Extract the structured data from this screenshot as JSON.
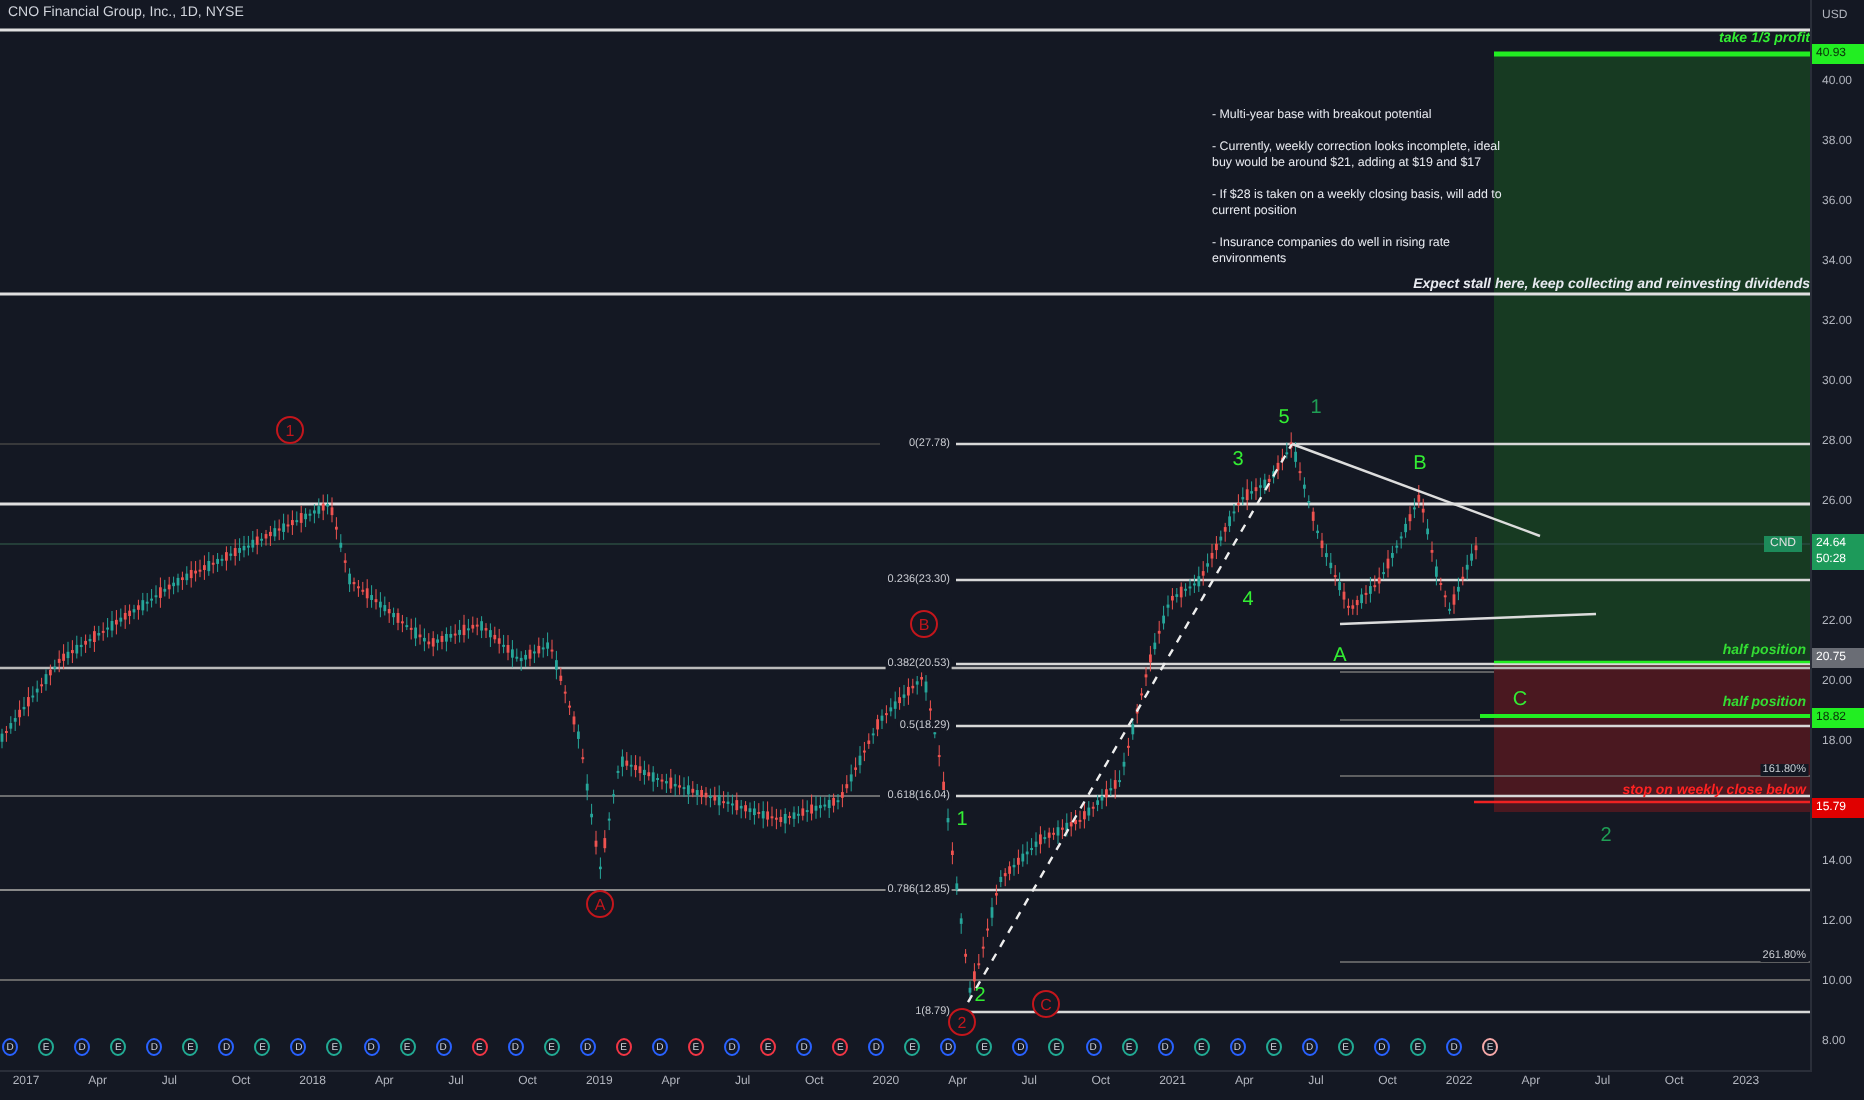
{
  "header": {
    "title": "CNO Financial Group, Inc., 1D, NYSE"
  },
  "notes": [
    "- Multi-year base with breakout potential",
    "- Currently, weekly correction looks incomplete, ideal buy would be around $21, adding at $19 and $17",
    "- If $28 is taken on a weekly closing basis, will add to current position",
    "- Insurance companies do well in rising rate environments"
  ],
  "annotations": [
    {
      "kind": "profit",
      "text": "take 1/3 profit"
    },
    {
      "kind": "note",
      "text": "Expect stall here, keep collecting and reinvesting dividends"
    },
    {
      "kind": "entry",
      "text": "half position"
    },
    {
      "kind": "entry",
      "text": "half position"
    },
    {
      "kind": "stop",
      "text": "stop on weekly close below"
    }
  ],
  "fib_levels": [
    "0(27.78)",
    "0.236(23.30)",
    "0.382(20.53)",
    "0.5(18.29)",
    "0.618(16.04)",
    "0.786(12.85)",
    "1(8.79)"
  ],
  "extensions": [
    "161.80%",
    "261.80%"
  ],
  "wave_labels": [
    {
      "text": "1",
      "kind": "circled",
      "color": "#c3161c"
    },
    {
      "text": "5",
      "kind": "plain",
      "color": "#33ee33"
    },
    {
      "text": "1",
      "kind": "plain",
      "color": "#1f9e55"
    },
    {
      "text": "3",
      "kind": "plain",
      "color": "#33ee33"
    },
    {
      "text": "B",
      "kind": "plain",
      "color": "#33ee33"
    },
    {
      "text": "B",
      "kind": "circled",
      "color": "#c3161c"
    },
    {
      "text": "4",
      "kind": "plain",
      "color": "#33ee33"
    },
    {
      "text": "A",
      "kind": "plain",
      "color": "#33ee33"
    },
    {
      "text": "C",
      "kind": "plain",
      "color": "#33ee33"
    },
    {
      "text": "1",
      "kind": "plain",
      "color": "#33ee33"
    },
    {
      "text": "2",
      "kind": "plain",
      "color": "#1f9e55"
    },
    {
      "text": "A",
      "kind": "circled",
      "color": "#c3161c"
    },
    {
      "text": "2",
      "kind": "plain",
      "color": "#33ee33"
    },
    {
      "text": "C",
      "kind": "circled",
      "color": "#c3161c"
    },
    {
      "text": "2",
      "kind": "circled",
      "color": "#c3161c"
    }
  ],
  "price_axis": {
    "currency": "USD",
    "ticks": [
      "40.00",
      "38.00",
      "36.00",
      "34.00",
      "32.00",
      "30.00",
      "28.00",
      "26.00",
      "22.00",
      "20.00",
      "18.00",
      "14.00",
      "12.00",
      "10.00",
      "8.00"
    ]
  },
  "symbol_tag": "CND",
  "price_tags": [
    {
      "kind": "target",
      "text": "40.93"
    },
    {
      "kind": "last",
      "text": "24.64",
      "countdown": "50:28"
    },
    {
      "kind": "level",
      "text": "20.75"
    },
    {
      "kind": "entry",
      "text": "18.82"
    },
    {
      "kind": "stop",
      "text": "15.79"
    }
  ],
  "events": [
    {
      "text": "D",
      "color": "#2962ff"
    },
    {
      "text": "E",
      "color": "#22ab94"
    },
    {
      "text": "D",
      "color": "#2962ff"
    },
    {
      "text": "E",
      "color": "#22ab94"
    },
    {
      "text": "D",
      "color": "#2962ff"
    },
    {
      "text": "E",
      "color": "#22ab94"
    },
    {
      "text": "D",
      "color": "#2962ff"
    },
    {
      "text": "E",
      "color": "#22ab94"
    },
    {
      "text": "D",
      "color": "#2962ff"
    },
    {
      "text": "E",
      "color": "#22ab94"
    },
    {
      "text": "D",
      "color": "#2962ff"
    },
    {
      "text": "E",
      "color": "#22ab94"
    },
    {
      "text": "D",
      "color": "#2962ff"
    },
    {
      "text": "E",
      "color": "#f23645"
    },
    {
      "text": "D",
      "color": "#2962ff"
    },
    {
      "text": "E",
      "color": "#22ab94"
    },
    {
      "text": "D",
      "color": "#2962ff"
    },
    {
      "text": "E",
      "color": "#f23645"
    },
    {
      "text": "D",
      "color": "#2962ff"
    },
    {
      "text": "E",
      "color": "#f23645"
    },
    {
      "text": "D",
      "color": "#2962ff"
    },
    {
      "text": "E",
      "color": "#f23645"
    },
    {
      "text": "D",
      "color": "#2962ff"
    },
    {
      "text": "E",
      "color": "#f23645"
    },
    {
      "text": "D",
      "color": "#2962ff"
    },
    {
      "text": "E",
      "color": "#22ab94"
    },
    {
      "text": "D",
      "color": "#2962ff"
    },
    {
      "text": "E",
      "color": "#22ab94"
    },
    {
      "text": "D",
      "color": "#2962ff"
    },
    {
      "text": "E",
      "color": "#22ab94"
    },
    {
      "text": "D",
      "color": "#2962ff"
    },
    {
      "text": "E",
      "color": "#22ab94"
    },
    {
      "text": "D",
      "color": "#2962ff"
    },
    {
      "text": "E",
      "color": "#22ab94"
    },
    {
      "text": "D",
      "color": "#2962ff"
    },
    {
      "text": "E",
      "color": "#22ab94"
    },
    {
      "text": "D",
      "color": "#2962ff"
    },
    {
      "text": "E",
      "color": "#22ab94"
    },
    {
      "text": "D",
      "color": "#2962ff"
    },
    {
      "text": "E",
      "color": "#22ab94"
    },
    {
      "text": "D",
      "color": "#2962ff"
    },
    {
      "text": "E",
      "color": "#f7a9a9"
    }
  ],
  "time_axis": [
    "2017",
    "Apr",
    "Jul",
    "Oct",
    "2018",
    "Apr",
    "Jul",
    "Oct",
    "2019",
    "Apr",
    "Jul",
    "Oct",
    "2020",
    "Apr",
    "Jul",
    "Oct",
    "2021",
    "Apr",
    "Jul",
    "Oct",
    "2022",
    "Apr",
    "Jul",
    "Oct",
    "2023"
  ]
}
